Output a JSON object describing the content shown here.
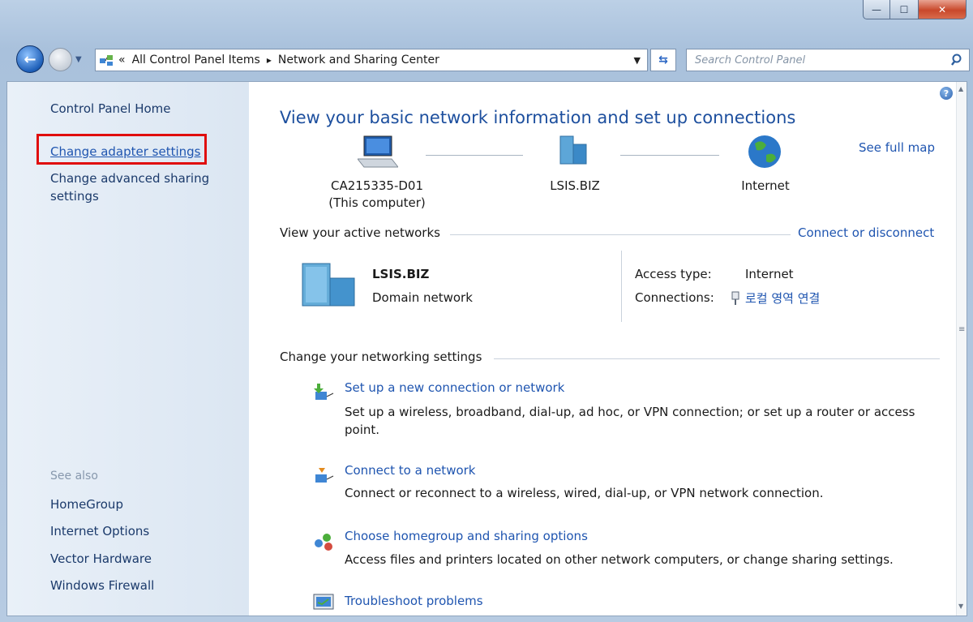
{
  "window": {
    "minimize_glyph": "—",
    "maximize_glyph": "☐",
    "close_glyph": "✕"
  },
  "address_bar": {
    "overflow": "«",
    "crumbs": [
      "All Control Panel Items",
      "Network and Sharing Center"
    ],
    "separator": "▸",
    "refresh_glyph": "⇆"
  },
  "search": {
    "placeholder": "Search Control Panel"
  },
  "sidebar": {
    "home": "Control Panel Home",
    "links": [
      "Change adapter settings",
      "Change advanced sharing",
      "settings"
    ],
    "see_also_label": "See also",
    "see_also": [
      "HomeGroup",
      "Internet Options",
      "Vector Hardware",
      "Windows Firewall"
    ]
  },
  "main": {
    "title": "View your basic network information and set up connections",
    "see_full_map": "See full map",
    "map": {
      "computer_name": "CA215335-D01",
      "computer_sub": "(This computer)",
      "domain": "LSIS.BIZ",
      "internet": "Internet"
    },
    "active_networks": {
      "header": "View your active networks",
      "connect_link": "Connect or disconnect",
      "network_name": "LSIS.BIZ",
      "network_type": "Domain network",
      "access_type_label": "Access type:",
      "access_type_value": "Internet",
      "connections_label": "Connections:",
      "connections_value": "로컬 영역 연결"
    },
    "networking_settings": {
      "header": "Change your networking settings",
      "tasks": [
        {
          "title": "Set up a new connection or network",
          "desc": "Set up a wireless, broadband, dial-up, ad hoc, or VPN connection; or set up a router or access point."
        },
        {
          "title": "Connect to a network",
          "desc": "Connect or reconnect to a wireless, wired, dial-up, or VPN network connection."
        },
        {
          "title": "Choose homegroup and sharing options",
          "desc": "Access files and printers located on other network computers, or change sharing settings."
        },
        {
          "title": "Troubleshoot problems",
          "desc": ""
        }
      ]
    }
  },
  "colors": {
    "link": "#1f55b0",
    "title": "#1d4f9e",
    "highlight": "#e00d0d"
  }
}
